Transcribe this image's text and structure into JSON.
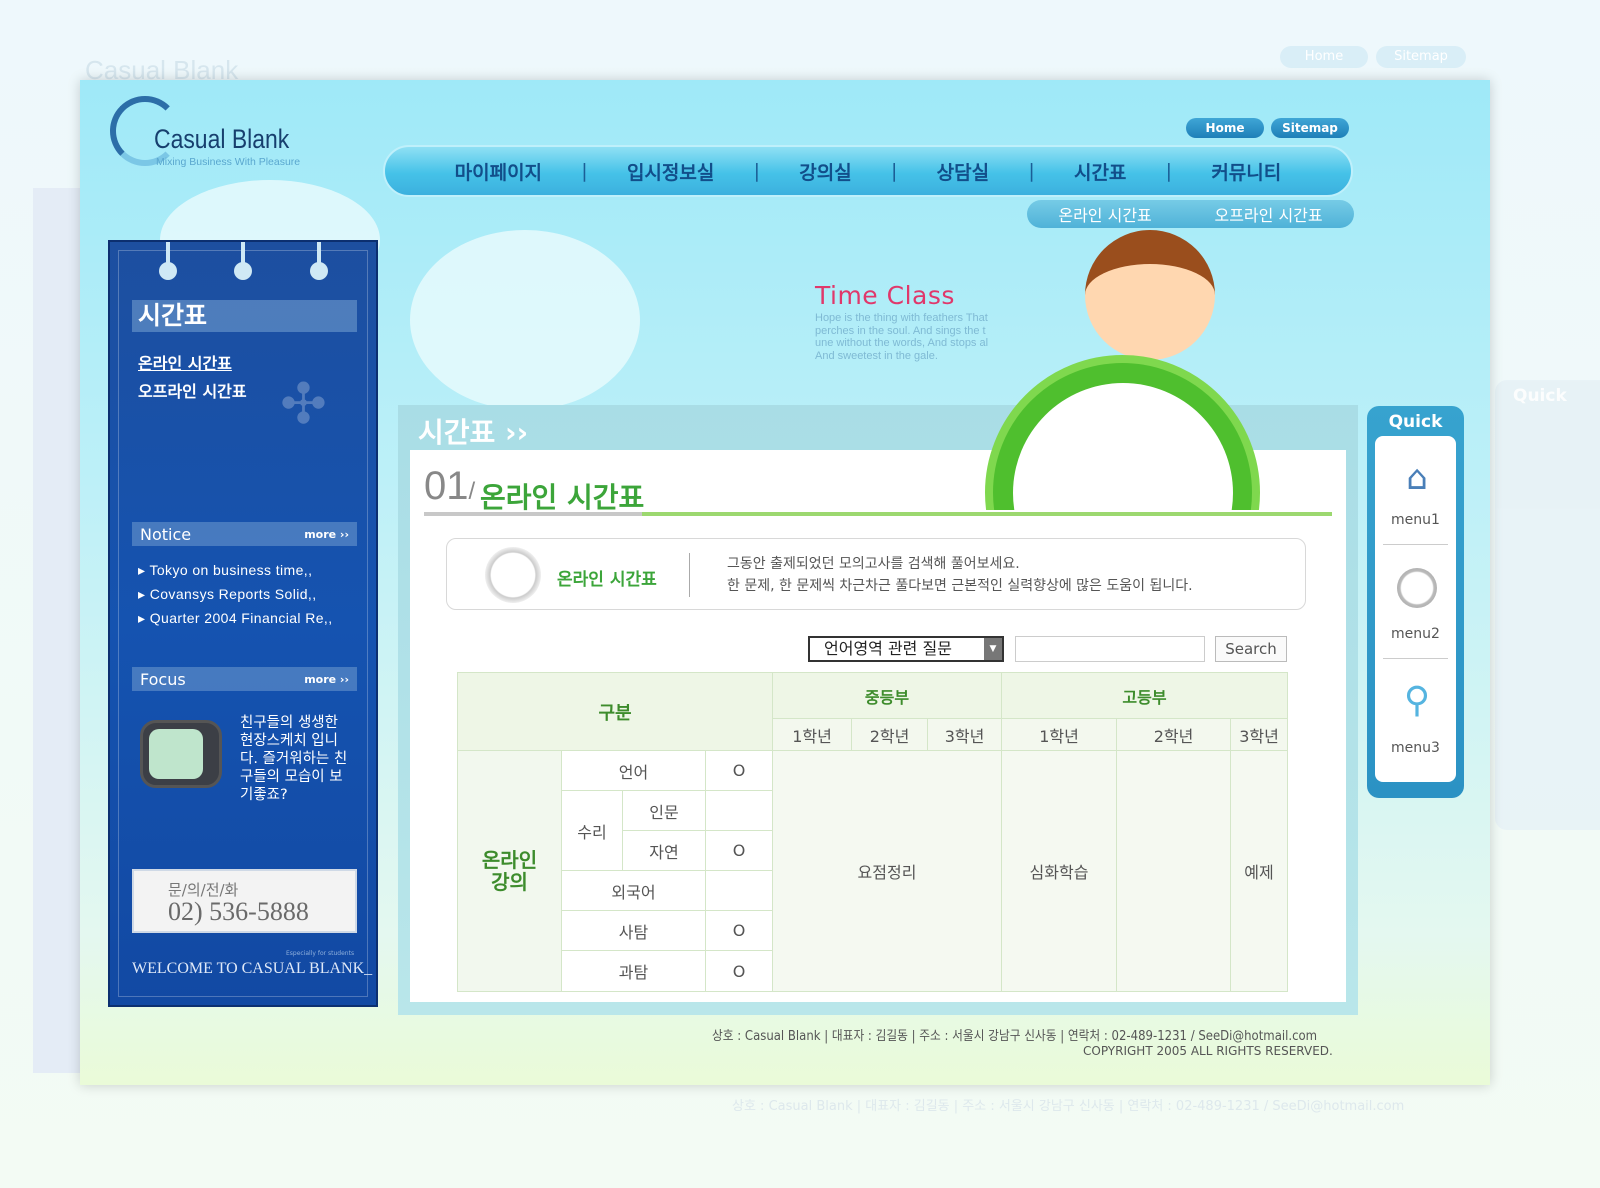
{
  "brand": {
    "name": "Casual Blank",
    "tagline": "Mixing Business With Pleasure"
  },
  "top_links": [
    "Home",
    "Sitemap"
  ],
  "gnb": [
    "마이페이지",
    "입시정보실",
    "강의실",
    "상담실",
    "시간표",
    "커뮤니티"
  ],
  "gnb_separator": "|",
  "sub_menu": [
    "온라인 시간표",
    "오프라인 시간표"
  ],
  "sidebar": {
    "title": "시간표",
    "links": [
      "온라인 시간표",
      "오프라인 시간표"
    ],
    "notice": {
      "title": "Notice",
      "more": "more ››",
      "items": [
        "Tokyo on business time,,",
        "Covansys Reports Solid,,",
        "Quarter 2004 Financial Re,,"
      ]
    },
    "focus": {
      "title": "Focus",
      "more": "more ››",
      "text": "친구들의 생생한 현장스케치 입니다. 즐거워하는 친구들의 모습이 보기좋죠?"
    },
    "phone": {
      "label": "문/의/전/화",
      "number": "02) 536-5888"
    },
    "welcome": "WELCOME TO CASUAL BLANK_",
    "welcome_sub": "Especially for students"
  },
  "hero": {
    "title": "Time Class",
    "text": "Hope is the thing with feathers That\nperches in the soul. And sings the t\nune without the words, And stops al\nAnd sweetest in the gale."
  },
  "content": {
    "section_title": "시간표 ››",
    "heading_number": "01",
    "heading_slash": "/",
    "heading": "온라인 시간표",
    "info_title": "온라인 시간표",
    "info_text": "그동안 출제되었던 모의고사를 검색해 풀어보세요.\n한 문제, 한 문제씩 차근차근 풀다보면 근본적인 실력향상에 많은 도움이 됩니다.",
    "search": {
      "select_value": "언어영역 관련 질문",
      "input_value": "",
      "button": "Search"
    },
    "table": {
      "h_category": "구분",
      "h_middle": "중등부",
      "h_high": "고등부",
      "grades": [
        "1학년",
        "2학년",
        "3학년",
        "1학년",
        "2학년",
        "3학년"
      ],
      "group": "온라인\n강의",
      "rows": [
        {
          "label": "언어",
          "mark": "O"
        },
        {
          "parent": "수리",
          "label": "인문",
          "mark": ""
        },
        {
          "label": "자연",
          "mark": "O"
        },
        {
          "label": "외국어",
          "mark": ""
        },
        {
          "label": "사탐",
          "mark": "O"
        },
        {
          "label": "과탐",
          "mark": "O"
        }
      ],
      "middle_value": "요점정리",
      "high1_value": "심화학습",
      "high2_value": "",
      "high3_value": "예제"
    }
  },
  "quick": {
    "title": "Quick",
    "items": [
      {
        "label": "menu1",
        "icon": "house-icon"
      },
      {
        "label": "menu2",
        "icon": "clock-icon"
      },
      {
        "label": "menu3",
        "icon": "magnifier-icon"
      }
    ]
  },
  "footer": {
    "line1": "상호 : Casual Blank  | 대표자 : 김길동 | 주소 : 서울시 강남구 신사동 | 연락처 : 02-489-1231 / SeeDi@hotmail.com",
    "line2": "COPYRIGHT   2005     ALL RIGHTS RESERVED."
  },
  "colors": {
    "accent_green": "#3ca53a",
    "nav_blue": "#45c2e8",
    "sidebar_blue": "#1553b0",
    "hero_pink": "#e0386b"
  }
}
